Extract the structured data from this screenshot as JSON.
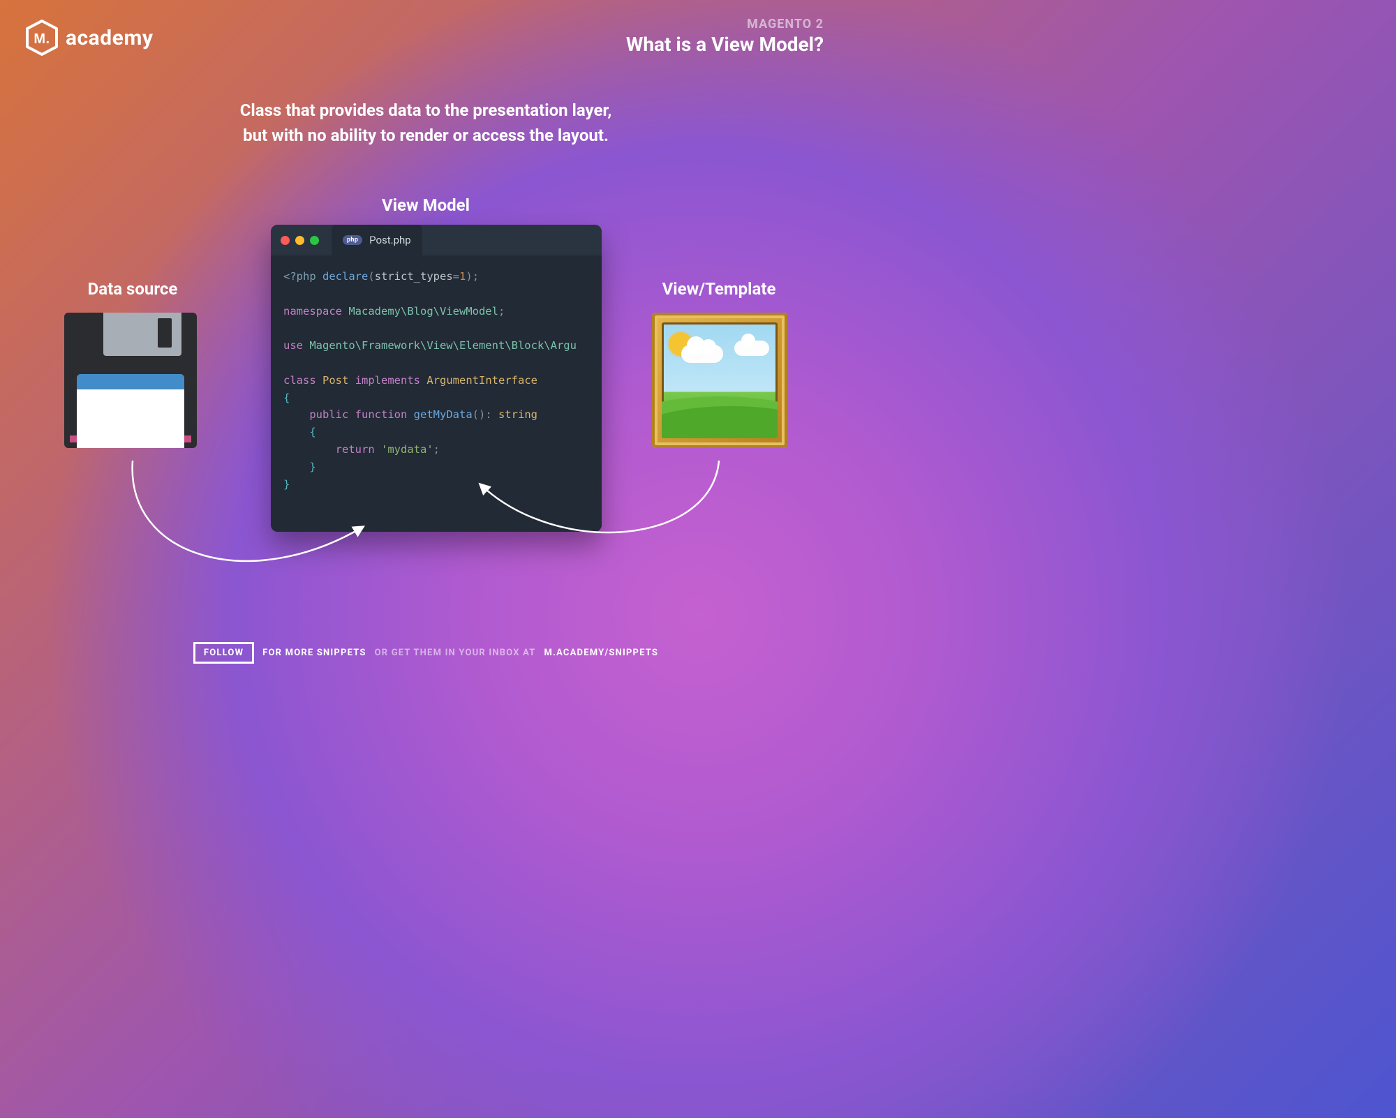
{
  "brand": {
    "name": "academy",
    "letter": "M."
  },
  "header": {
    "category": "MAGENTO 2",
    "title": "What is a View Model?"
  },
  "subtitle_line1": "Class that provides data to the presentation layer,",
  "subtitle_line2": "but with no ability to render or access the layout.",
  "labels": {
    "view_model": "View Model",
    "data_source": "Data source",
    "view_template": "View/Template"
  },
  "code_window": {
    "filename": "Post.php",
    "lang_badge": "php",
    "code": {
      "open_tag": "<?php",
      "declare_kw": "declare",
      "strict_key": "strict_types",
      "strict_val": "1",
      "namespace_kw": "namespace",
      "namespace_path": "Macademy\\Blog\\ViewModel",
      "use_kw": "use",
      "use_path": "Magento\\Framework\\View\\Element\\Block\\Argu",
      "class_kw": "class",
      "class_name": "Post",
      "implements_kw": "implements",
      "interface_name": "ArgumentInterface",
      "public_kw": "public",
      "function_kw": "function",
      "method_name": "getMyData",
      "return_type": "string",
      "return_kw": "return",
      "return_str": "'mydata'"
    }
  },
  "footer": {
    "follow": "FOLLOW",
    "for_more": "FOR MORE SNIPPETS",
    "or_get": "OR GET THEM IN YOUR INBOX AT",
    "url": "M.ACADEMY/SNIPPETS"
  }
}
